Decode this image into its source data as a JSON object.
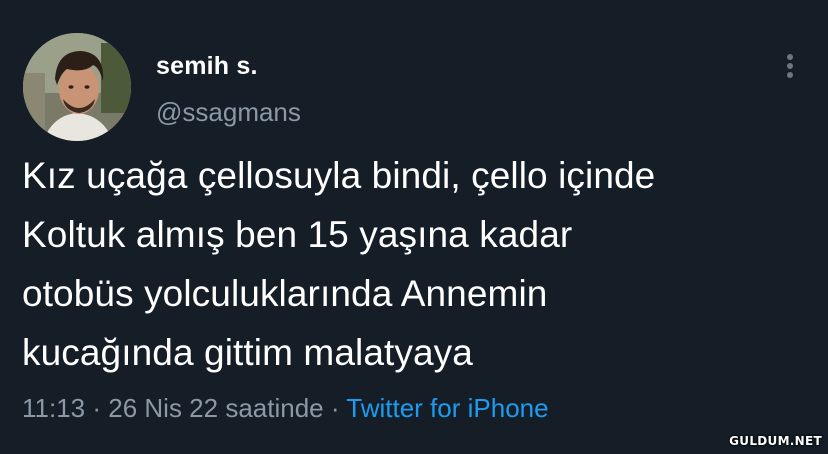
{
  "author": {
    "display_name": "semih s.",
    "handle": "@ssagmans"
  },
  "tweet": {
    "lines": [
      "Kız uçağa çellosuyla bindi, çello içinde",
      "Koltuk almış ben 15 yaşına kadar",
      "otobüs yolculuklarında Annemin",
      "kucağında gittim malatyaya"
    ]
  },
  "meta": {
    "time": "11:13",
    "separator": " · ",
    "date": "26 Nis 22 saatinde",
    "separator2": " · ",
    "source": "Twitter for iPhone"
  },
  "icons": {
    "more": "more-vertical-icon"
  },
  "watermark": "GULDUM.NET",
  "colors": {
    "background": "#151e27",
    "secondary_text": "#8b98a5",
    "link": "#1d9bf0"
  }
}
